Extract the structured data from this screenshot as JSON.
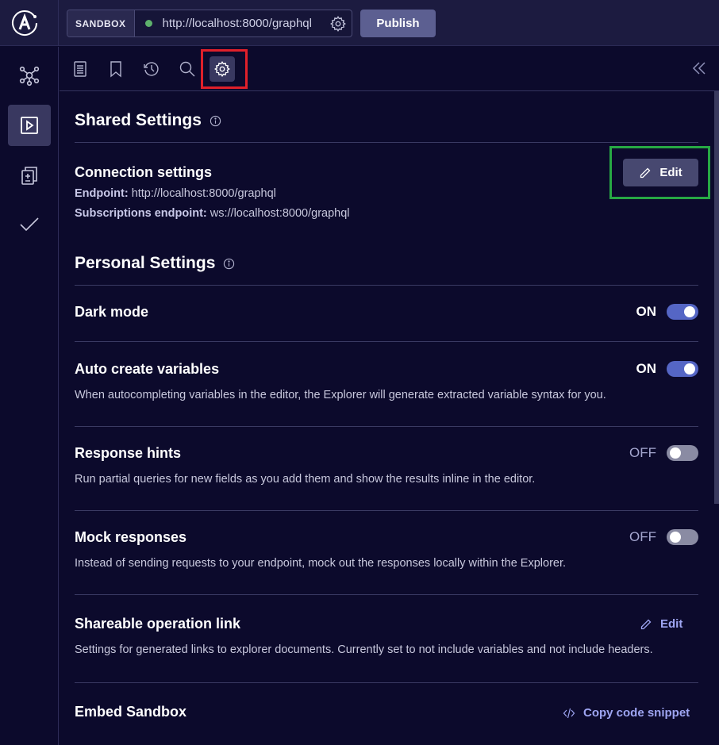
{
  "topbar": {
    "logo": "apollo-logo",
    "sandbox_tag": "SANDBOX",
    "endpoint_url": "http://localhost:8000/graphql",
    "status_color": "#5eb16c",
    "publish_label": "Publish"
  },
  "sidebar": {
    "items": [
      {
        "name": "schema",
        "icon": "graph-nodes-icon",
        "active": false
      },
      {
        "name": "explorer",
        "icon": "play-square-icon",
        "active": true
      },
      {
        "name": "diff",
        "icon": "diff-documents-icon",
        "active": false
      },
      {
        "name": "checks",
        "icon": "checkmark-icon",
        "active": false
      }
    ]
  },
  "tabs": [
    {
      "name": "documentation",
      "icon": "document-icon",
      "active": false
    },
    {
      "name": "saved-operations",
      "icon": "bookmark-icon",
      "active": false
    },
    {
      "name": "history",
      "icon": "history-icon",
      "active": false
    },
    {
      "name": "search",
      "icon": "search-icon",
      "active": false
    },
    {
      "name": "settings",
      "icon": "gear-icon",
      "active": true
    }
  ],
  "shared": {
    "title": "Shared Settings",
    "connection": {
      "title": "Connection settings",
      "edit_label": "Edit",
      "endpoint_label": "Endpoint:",
      "endpoint_value": "http://localhost:8000/graphql",
      "subs_label": "Subscriptions endpoint:",
      "subs_value": "ws://localhost:8000/graphql"
    }
  },
  "personal": {
    "title": "Personal Settings",
    "settings": [
      {
        "title": "Dark mode",
        "state": "ON",
        "on": true,
        "description": ""
      },
      {
        "title": "Auto create variables",
        "state": "ON",
        "on": true,
        "description": "When autocompleting variables in the editor, the Explorer will generate extracted variable syntax for you."
      },
      {
        "title": "Response hints",
        "state": "OFF",
        "on": false,
        "description": "Run partial queries for new fields as you add them and show the results inline in the editor."
      },
      {
        "title": "Mock responses",
        "state": "OFF",
        "on": false,
        "description": "Instead of sending requests to your endpoint, mock out the responses locally within the Explorer."
      }
    ],
    "shareable": {
      "title": "Shareable operation link",
      "action": "Edit",
      "description": "Settings for generated links to explorer documents. Currently set to not include variables and not include headers."
    },
    "embed": {
      "title": "Embed Sandbox",
      "action": "Copy code snippet"
    }
  }
}
